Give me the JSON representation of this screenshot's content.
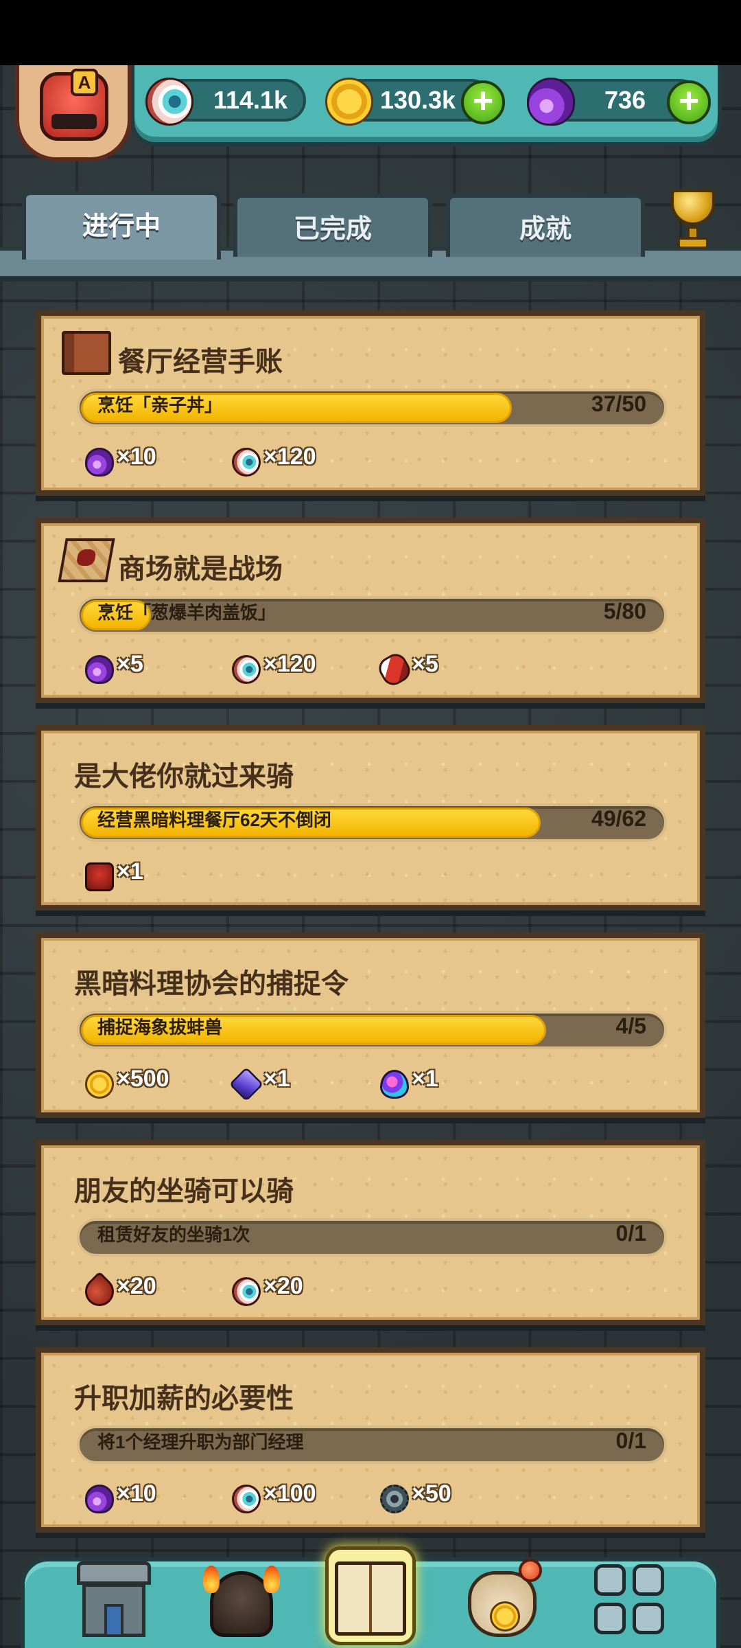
{
  "header": {
    "rank_letter": "A",
    "eyes": "114.1k",
    "coins": "130.3k",
    "potions": "736",
    "plus_label": "+"
  },
  "tabs": [
    {
      "label": "进行中",
      "active": true
    },
    {
      "label": "已完成",
      "active": false
    },
    {
      "label": "成就",
      "active": false
    }
  ],
  "quests": [
    {
      "title": "餐厅经营手账",
      "icon": "journal-book-icon",
      "task": "烹饪「亲子丼」",
      "count": "37/50",
      "progress": 0.74,
      "rewards": [
        {
          "icon": "purple-potion-icon",
          "qty": "×10"
        },
        {
          "icon": "eyeball-icon",
          "qty": "×120"
        }
      ]
    },
    {
      "title": "商场就是战场",
      "icon": "treasure-map-icon",
      "task": "烹饪「葱爆羊肉盖饭」",
      "count": "5/80",
      "progress": 0.0625,
      "rewards": [
        {
          "icon": "purple-potion-icon",
          "qty": "×5"
        },
        {
          "icon": "eyeball-icon",
          "qty": "×120"
        },
        {
          "icon": "meat-ticket-icon",
          "qty": "×5"
        }
      ]
    },
    {
      "title": "是大佬你就过来骑",
      "task": "经营黑暗料理餐厅62天不倒闭",
      "count": "49/62",
      "progress": 0.79,
      "rewards": [
        {
          "icon": "red-mount-icon",
          "qty": "×1"
        }
      ]
    },
    {
      "title": "黑暗料理协会的捕捉令",
      "task": "捕捉海象拔蚌兽",
      "count": "4/5",
      "progress": 0.8,
      "rewards": [
        {
          "icon": "gold-coin-icon",
          "qty": "×500"
        },
        {
          "icon": "crystal-icon",
          "qty": "×1"
        },
        {
          "icon": "rainbow-egg-icon",
          "qty": "×1"
        }
      ]
    },
    {
      "title": "朋友的坐骑可以骑",
      "task": "租赁好友的坐骑1次",
      "count": "0/1",
      "progress": 0,
      "rewards": [
        {
          "icon": "blood-drop-icon",
          "qty": "×20"
        },
        {
          "icon": "eyeball-icon",
          "qty": "×20"
        }
      ]
    },
    {
      "title": "升职加薪的必要性",
      "task": "将1个经理升职为部门经理",
      "count": "0/1",
      "progress": 0,
      "rewards": [
        {
          "icon": "purple-potion-icon",
          "qty": "×10"
        },
        {
          "icon": "eyeball-icon",
          "qty": "×100"
        },
        {
          "icon": "gear-token-icon",
          "qty": "×50"
        }
      ]
    }
  ],
  "colors": {
    "progress_fill": "#f2b400",
    "card_bg": "#e7c68d",
    "header_teal": "#4fb7b4"
  },
  "bottom_nav": [
    {
      "icon": "restaurant-icon"
    },
    {
      "icon": "kitchen-pot-icon"
    },
    {
      "icon": "quest-book-icon",
      "active": true
    },
    {
      "icon": "money-bag-icon",
      "has_notification": true
    },
    {
      "icon": "menu-grid-icon"
    }
  ]
}
